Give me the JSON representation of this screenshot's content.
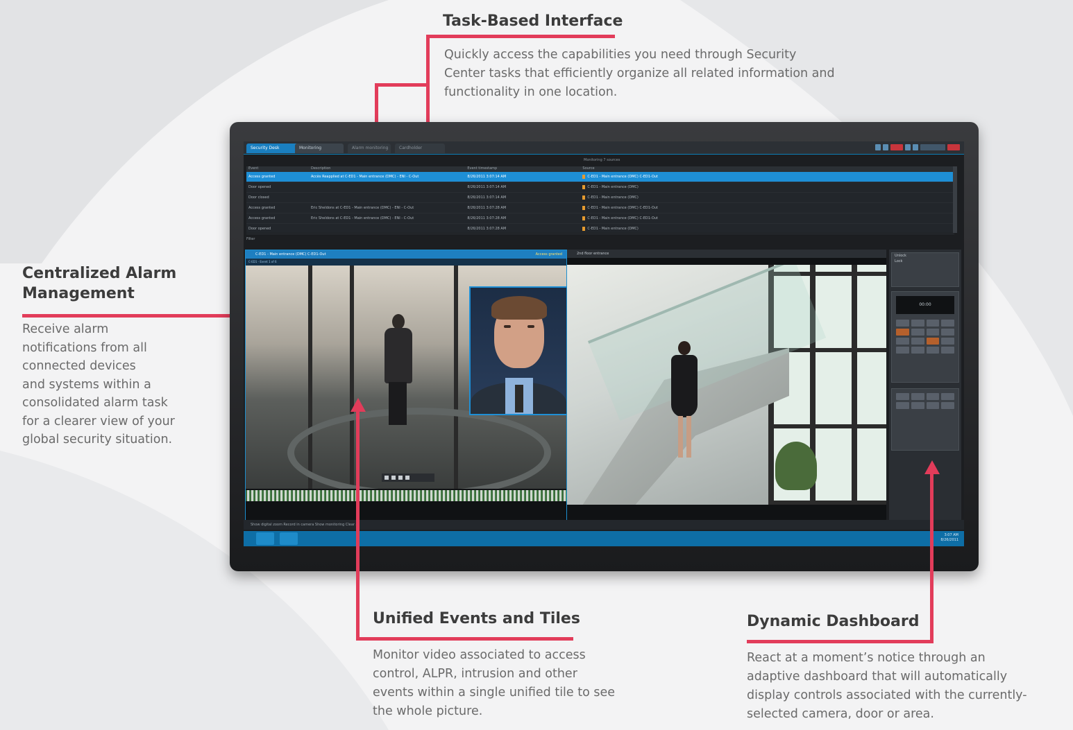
{
  "callouts": {
    "task": {
      "title": "Task-Based Interface",
      "body_lines": [
        "Quickly access the capabilities you need through Security",
        "Center tasks that efficiently organize all related information and",
        "functionality in one location."
      ]
    },
    "alarm": {
      "title_lines": [
        "Centralized Alarm",
        "Management"
      ],
      "body_lines": [
        "Receive alarm",
        "notifications from all",
        "connected devices",
        "and systems within a",
        "consolidated alarm task",
        "for a clearer view of your",
        "global security situation."
      ]
    },
    "tiles": {
      "title": "Unified Events and Tiles",
      "body_lines": [
        "Monitor video associated to access",
        "control, ALPR, intrusion and other",
        "events within a single unified tile to see",
        "the whole picture."
      ]
    },
    "dashboard": {
      "title": "Dynamic Dashboard",
      "body_lines": [
        "React at a moment’s notice through an",
        "adaptive dashboard that will automatically",
        "display controls associated with the currently-",
        "selected camera, door or area."
      ]
    }
  },
  "colors": {
    "accent_red": "#e23c5a",
    "screen_blue": "#1e8fd6"
  },
  "screen": {
    "tabs": [
      "Security Desk",
      "Monitoring",
      "Alarm monitoring",
      "Cardholder"
    ],
    "table_headers": [
      "Event",
      "Description",
      "Event timestamp",
      "Source"
    ],
    "rows": [
      {
        "event": "Access granted",
        "desc": "Accès Reapplied at C-ED1 - Main entrance (DMC) - ENI - C-Out",
        "time": "8/26/2011 3:07:14 AM",
        "source": "C-ED1 - Main entrance (DMC) C-ED1-Out",
        "selected": true
      },
      {
        "event": "Door opened",
        "desc": "",
        "time": "8/26/2011 3:07:14 AM",
        "source": "C-ED1 - Main entrance (DMC)",
        "selected": false
      },
      {
        "event": "Door closed",
        "desc": "",
        "time": "8/26/2011 3:07:14 AM",
        "source": "C-ED1 - Main entrance (DMC)",
        "selected": false
      },
      {
        "event": "Access granted",
        "desc": "Eric Sheldons at C-ED1 - Main entrance (DMC) - ENI - C-Out",
        "time": "8/26/2011 3:07:28 AM",
        "source": "C-ED1 - Main entrance (DMC) C-ED1-Out",
        "selected": false
      },
      {
        "event": "Access granted",
        "desc": "Eric Sheldons at C-ED1 - Main entrance (DMC) - ENI - C-Out",
        "time": "8/26/2011 3:07:28 AM",
        "source": "C-ED1 - Main entrance (DMC) C-ED1-Out",
        "selected": false
      },
      {
        "event": "Door opened",
        "desc": "",
        "time": "8/26/2011 3:07:28 AM",
        "source": "C-ED1 - Main entrance (DMC)",
        "selected": false
      }
    ],
    "subhead": "Monitoring 7 sources",
    "filter": "Filter",
    "tile1_title": "C-ED1 - Main entrance (DMC) C-ED1-Out",
    "tile1_status": "Access granted",
    "tile1_sub": "C-ED1 - Event 1 of 6",
    "tile2_title": "2nd floor entrance",
    "dash_items": [
      "Unlock",
      "Lock"
    ],
    "dash_display": "00:00",
    "statusbar": "Show digital zoom   Record in camera   Show monitoring   Clear all",
    "clock": [
      "3:07 AM",
      "8/26/2011"
    ]
  }
}
